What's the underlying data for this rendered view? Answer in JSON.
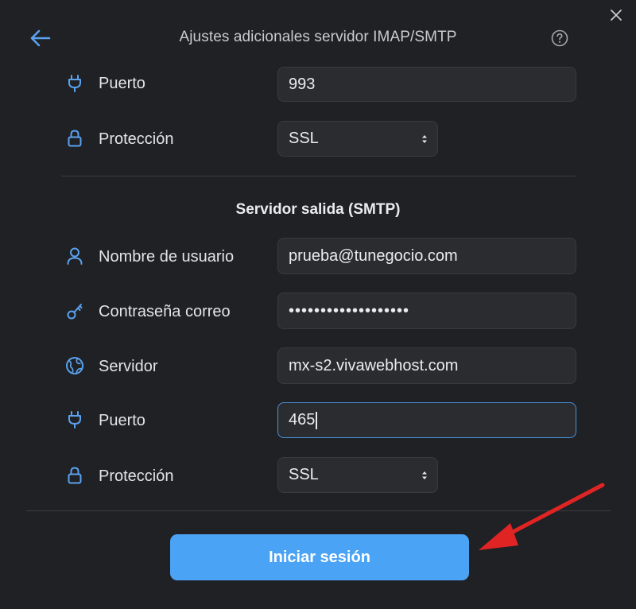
{
  "header": {
    "title": "Ajustes adicionales servidor IMAP/SMTP"
  },
  "imap": {
    "port_label": "Puerto",
    "port_value": "993",
    "protection_label": "Protección",
    "protection_value": "SSL"
  },
  "smtp": {
    "section_title": "Servidor salida (SMTP)",
    "username_label": "Nombre de usuario",
    "username_value": "prueba@tunegocio.com",
    "password_label": "Contraseña correo",
    "password_value": "•••••••••••••••••••",
    "server_label": "Servidor",
    "server_value": "mx-s2.vivawebhost.com",
    "port_label": "Puerto",
    "port_value": "465",
    "protection_label": "Protección",
    "protection_value": "SSL"
  },
  "footer": {
    "login_label": "Iniciar sesión"
  },
  "colors": {
    "background": "#202124",
    "accent": "#4ba3f5",
    "icon": "#5aa2ee",
    "annotation_arrow": "#e02424"
  },
  "icons": {
    "back": "arrow-left-icon",
    "close": "close-icon",
    "help": "help-icon",
    "port": "plug-icon",
    "protection": "lock-icon",
    "username": "user-icon",
    "password": "key-icon",
    "server": "globe-icon",
    "select": "select-arrows-icon"
  }
}
